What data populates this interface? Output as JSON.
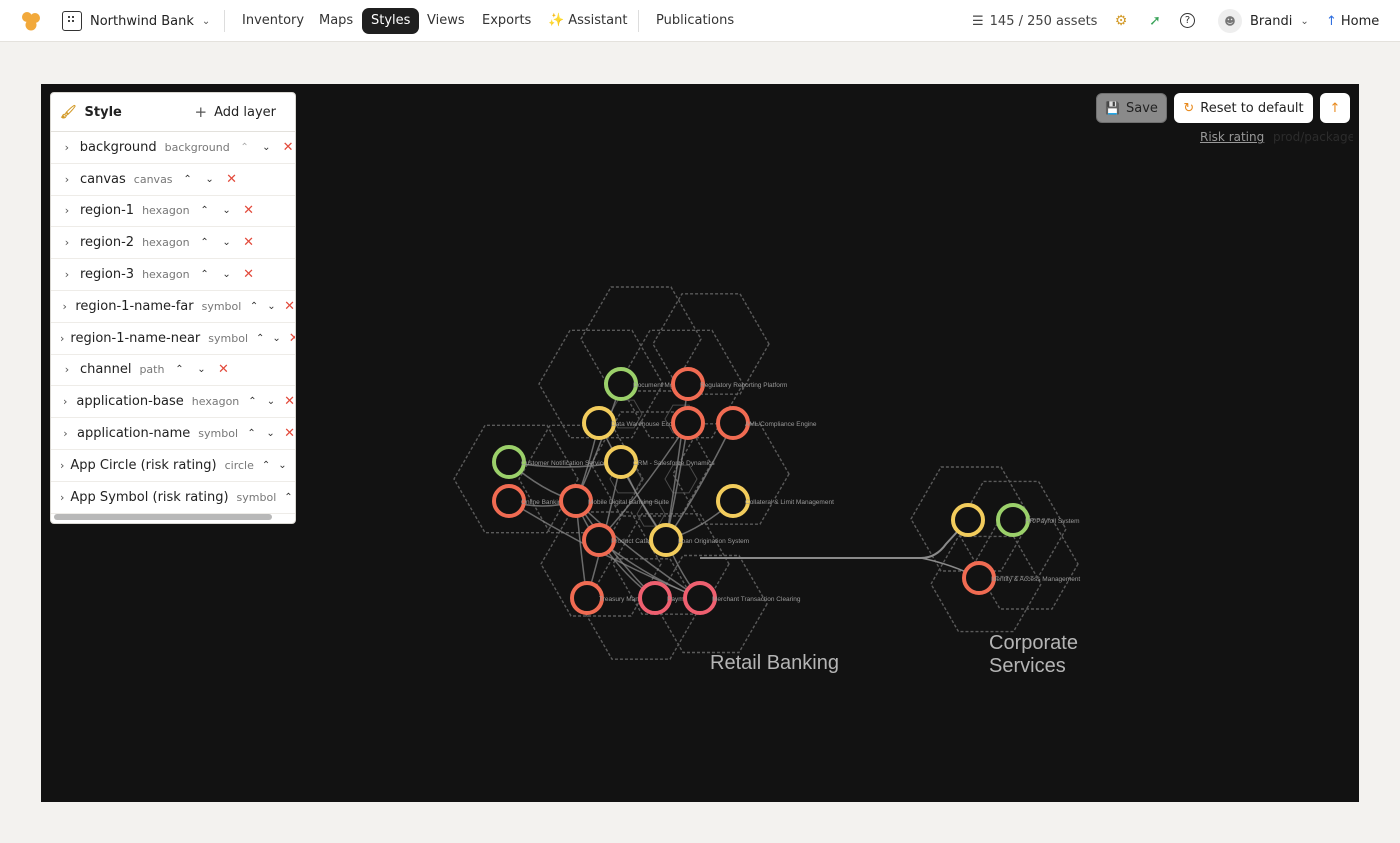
{
  "header": {
    "org_name": "Northwind Bank",
    "nav": [
      "Inventory",
      "Maps",
      "Styles",
      "Views",
      "Exports",
      "Assistant",
      "Publications"
    ],
    "active_nav": "Styles",
    "asset_count": "145 / 250 assets",
    "user_name": "Brandi",
    "home_label": "Home"
  },
  "panel": {
    "title": "Style",
    "add_layer_label": "Add layer",
    "layers": [
      {
        "name": "background",
        "type": "background"
      },
      {
        "name": "canvas",
        "type": "canvas"
      },
      {
        "name": "region-1",
        "type": "hexagon"
      },
      {
        "name": "region-2",
        "type": "hexagon"
      },
      {
        "name": "region-3",
        "type": "hexagon"
      },
      {
        "name": "region-1-name-far",
        "type": "symbol"
      },
      {
        "name": "region-1-name-near",
        "type": "symbol"
      },
      {
        "name": "channel",
        "type": "path"
      },
      {
        "name": "application-base",
        "type": "hexagon"
      },
      {
        "name": "application-name",
        "type": "symbol"
      },
      {
        "name": "App Circle (risk rating)",
        "type": "circle"
      },
      {
        "name": "App Symbol (risk rating)",
        "type": "symbol"
      }
    ]
  },
  "toolbar": {
    "save_label": "Save",
    "reset_label": "Reset to default",
    "legend_label": "Risk rating",
    "legend_ghost": "prod/packages"
  },
  "map": {
    "region_labels": [
      "Retail Banking",
      "Corporate Services"
    ],
    "colors": {
      "background": "#121212",
      "hex_stroke": "#5a5a5a",
      "risk_green": "#9bd06a",
      "risk_yellow": "#f2cc5c",
      "risk_orange": "#f06b52",
      "risk_pink": "#ee5f6f"
    },
    "apps": [
      {
        "label": "Document Mgmt System",
        "risk": "green"
      },
      {
        "label": "Regulatory Reporting Platform",
        "risk": "orange"
      },
      {
        "label": "Data Warehouse Ecosystem",
        "risk": "yellow"
      },
      {
        "label": "",
        "risk": "orange"
      },
      {
        "label": "AML/Compliance Engine",
        "risk": "orange"
      },
      {
        "label": "Customer Notification Service",
        "risk": "green"
      },
      {
        "label": "CRM - Salesforce Dynamics",
        "risk": "yellow"
      },
      {
        "label": "Online Banking",
        "risk": "orange"
      },
      {
        "label": "Mobile Digital Banking Suite",
        "risk": "orange"
      },
      {
        "label": "Collateral & Limit Management",
        "risk": "yellow"
      },
      {
        "label": "Product Catalog",
        "risk": "orange"
      },
      {
        "label": "Loan Origination System",
        "risk": "yellow"
      },
      {
        "label": "Treasury Management",
        "risk": "orange"
      },
      {
        "label": "Payment Hub",
        "risk": "pink"
      },
      {
        "label": "Merchant Transaction Clearing",
        "risk": "pink"
      },
      {
        "label": "",
        "risk": "yellow"
      },
      {
        "label": "HR/Payroll System",
        "risk": "green"
      },
      {
        "label": "Identity & Access Management",
        "risk": "orange"
      }
    ]
  }
}
